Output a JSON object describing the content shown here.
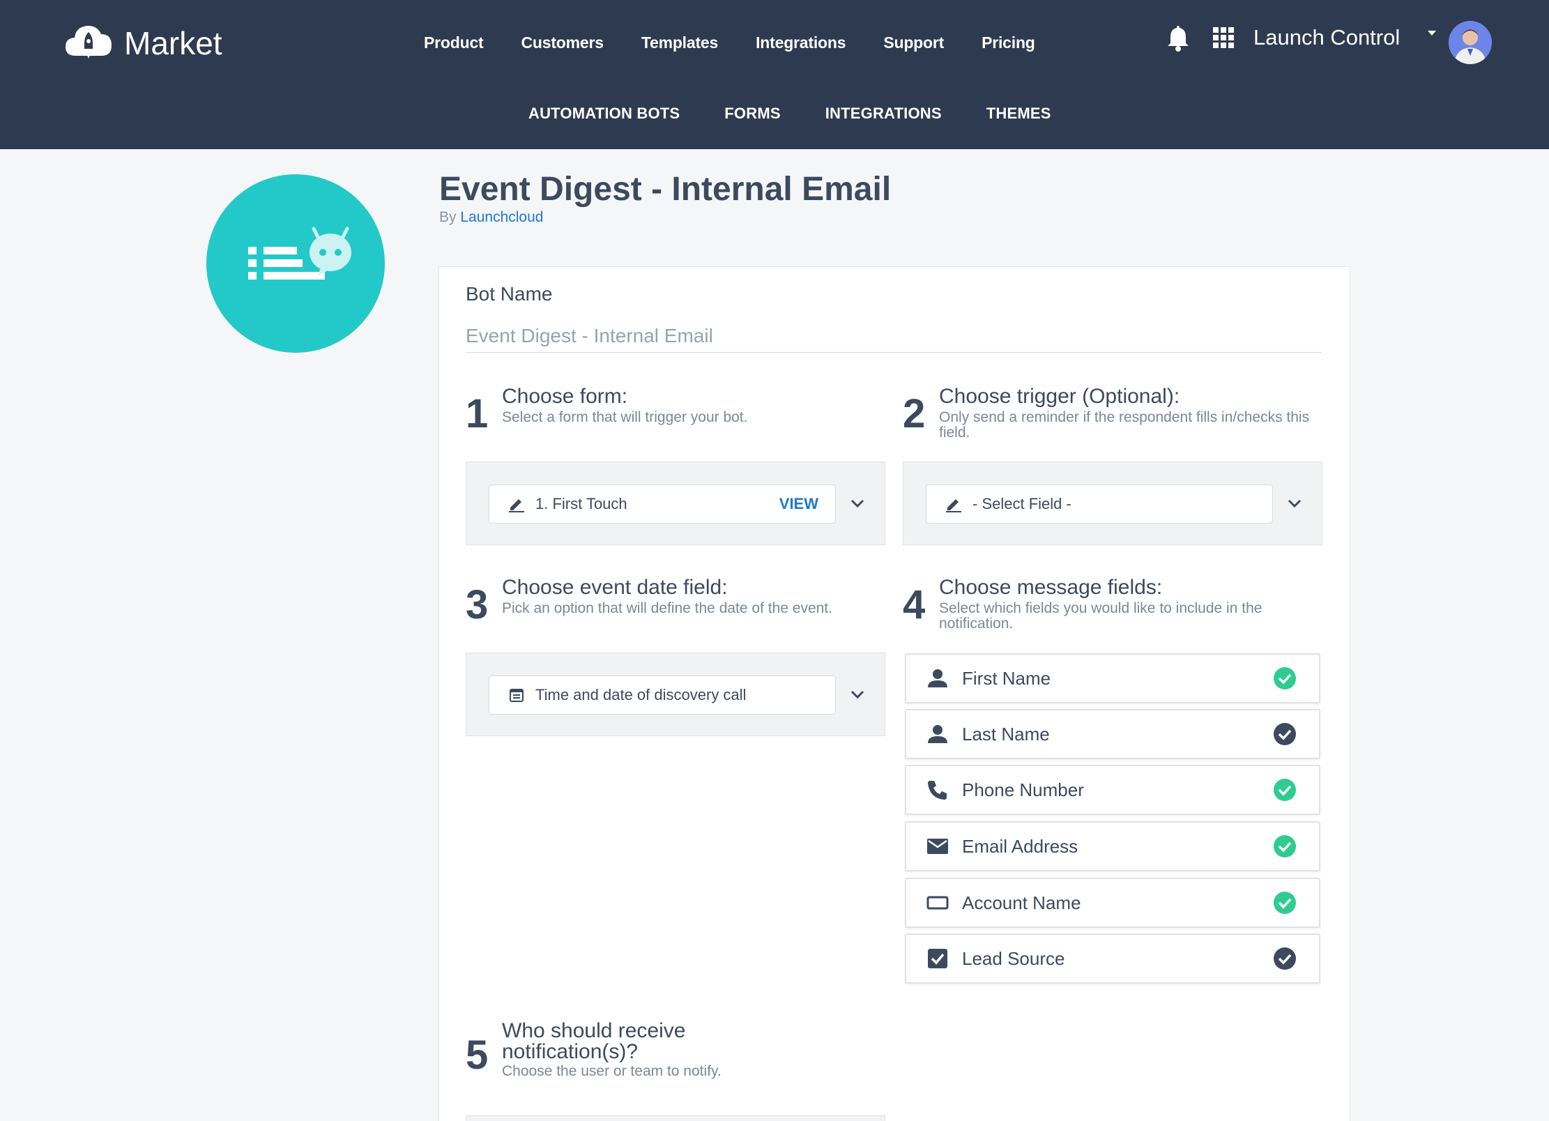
{
  "brand": {
    "name": "Market"
  },
  "nav": {
    "main": [
      "Product",
      "Customers",
      "Templates",
      "Integrations",
      "Support",
      "Pricing"
    ],
    "sub": [
      "AUTOMATION BOTS",
      "FORMS",
      "INTEGRATIONS",
      "THEMES"
    ]
  },
  "account": {
    "workspace": "Launch Control"
  },
  "page": {
    "title": "Event Digest - Internal Email",
    "by_prefix": "By",
    "author": "Launchcloud"
  },
  "bot_name": {
    "label": "Bot Name",
    "value": "Event Digest - Internal Email"
  },
  "steps": {
    "s1": {
      "num": "1",
      "title": "Choose form:",
      "desc": "Select a form that will trigger your bot.",
      "selected": "1. First Touch",
      "action": "VIEW"
    },
    "s2": {
      "num": "2",
      "title": "Choose trigger (Optional):",
      "desc": "Only send a reminder if the respondent fills in/checks this field.",
      "selected": "- Select Field -"
    },
    "s3": {
      "num": "3",
      "title": "Choose event date field:",
      "desc": "Pick an option that will define the date of the event.",
      "selected": "Time and date of discovery call"
    },
    "s4": {
      "num": "4",
      "title": "Choose message fields:",
      "desc": "Select which fields you would like to include in the notification."
    },
    "s5": {
      "num": "5",
      "title": "Who should receive notification(s)?",
      "desc": "Choose the user or team to notify."
    }
  },
  "message_fields": [
    {
      "label": "First Name",
      "icon": "person-icon",
      "check_color": "#2ecc8f"
    },
    {
      "label": "Last Name",
      "icon": "person-icon",
      "check_color": "#3c4a5e"
    },
    {
      "label": "Phone Number",
      "icon": "phone-icon",
      "check_color": "#2ecc8f"
    },
    {
      "label": "Email Address",
      "icon": "envelope-icon",
      "check_color": "#2ecc8f"
    },
    {
      "label": "Account Name",
      "icon": "rectangle-icon",
      "check_color": "#2ecc8f"
    },
    {
      "label": "Lead Source",
      "icon": "checkbox-icon",
      "check_color": "#3c4a5e"
    }
  ],
  "colors": {
    "header_bg": "#2e3a50",
    "accent_teal": "#23c9c9",
    "link_blue": "#1f78d1",
    "check_green": "#2ecc8f",
    "check_dark": "#3c4a5e"
  }
}
